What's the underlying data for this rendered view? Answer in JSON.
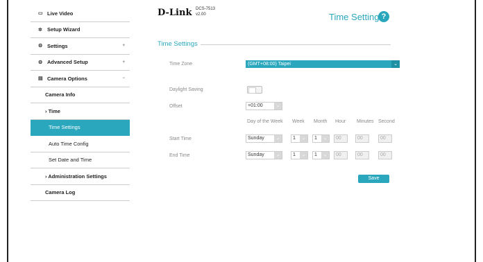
{
  "sidebar": {
    "items": [
      {
        "label": "Live Video",
        "icon": "video-icon"
      },
      {
        "label": "Setup Wizard",
        "icon": "wizard-icon"
      },
      {
        "label": "Settings",
        "icon": "gear-icon"
      },
      {
        "label": "Advanced Setup",
        "icon": "advanced-gear-icon"
      },
      {
        "label": "Camera Options",
        "icon": "camera-icon"
      },
      {
        "label": "Camera Info"
      },
      {
        "label": "Time",
        "prefix": "›"
      },
      {
        "label": "Time Settings"
      },
      {
        "label": "Auto Time Config"
      },
      {
        "label": "Set Date and Time"
      },
      {
        "label": "Administration Settings",
        "prefix": "›"
      },
      {
        "label": "Camera Log"
      }
    ]
  },
  "header": {
    "logo": "D-Link",
    "model": "DCS-7513",
    "version": "v2.00",
    "title": "Time Settings",
    "help": "?"
  },
  "section_title": "Time Settings",
  "form": {
    "time_zone_label": "Time Zone",
    "time_zone_value": "(GMT+08:00) Taipei",
    "daylight_label": "Daylight Saving",
    "daylight_on": false,
    "offset_label": "Offset",
    "offset_value": "+01:00",
    "columns": [
      "Day of the Week",
      "Week",
      "Month",
      "Hour",
      "Minutes",
      "Second"
    ],
    "start_label": "Start Time",
    "end_label": "End Time",
    "start": {
      "day": "Sunday",
      "week": "1",
      "month": "1",
      "hour": "00",
      "minutes": "00",
      "second": "00"
    },
    "end": {
      "day": "Sunday",
      "week": "1",
      "month": "1",
      "hour": "00",
      "minutes": "00",
      "second": "00"
    },
    "save_label": "Save"
  },
  "colors": {
    "accent": "#2aa7bd"
  }
}
